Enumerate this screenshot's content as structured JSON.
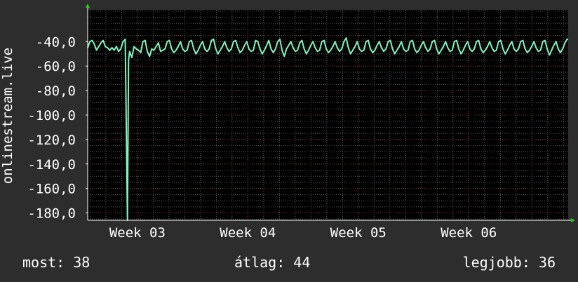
{
  "chart_data": {
    "type": "line",
    "ylabel": "onlinestream.live",
    "yticks": [
      "-40,0",
      "-60,0",
      "-80,0",
      "-100,0",
      "-120,0",
      "-140,0",
      "-160,0",
      "-180,0"
    ],
    "ytick_values": [
      -40,
      -60,
      -80,
      -100,
      -120,
      -140,
      -160,
      -180
    ],
    "ylim": [
      -186,
      -14
    ],
    "xticks": [
      "Week 03",
      "Week 04",
      "Week 05",
      "Week 06"
    ],
    "xtick_values": [
      3,
      4,
      5,
      6
    ],
    "xlim": [
      2.55,
      6.9
    ],
    "grid": true,
    "series": [
      {
        "color": "#7ff5bd",
        "points": [
          [
            2.55,
            -45
          ],
          [
            2.57,
            -40
          ],
          [
            2.59,
            -39
          ],
          [
            2.61,
            -42
          ],
          [
            2.63,
            -47
          ],
          [
            2.65,
            -44
          ],
          [
            2.67,
            -41
          ],
          [
            2.69,
            -39
          ],
          [
            2.71,
            -44
          ],
          [
            2.73,
            -45
          ],
          [
            2.75,
            -47
          ],
          [
            2.77,
            -45
          ],
          [
            2.79,
            -47
          ],
          [
            2.81,
            -44
          ],
          [
            2.83,
            -48
          ],
          [
            2.85,
            -46
          ],
          [
            2.87,
            -40
          ],
          [
            2.89,
            -38
          ],
          [
            2.91,
            -186
          ],
          [
            2.92,
            -55
          ],
          [
            2.93,
            -48
          ],
          [
            2.95,
            -53
          ],
          [
            2.97,
            -44
          ],
          [
            2.99,
            -46
          ],
          [
            3.01,
            -47
          ],
          [
            3.03,
            -49
          ],
          [
            3.05,
            -40
          ],
          [
            3.07,
            -39
          ],
          [
            3.09,
            -48
          ],
          [
            3.11,
            -52
          ],
          [
            3.13,
            -46
          ],
          [
            3.15,
            -47
          ],
          [
            3.17,
            -44
          ],
          [
            3.19,
            -41
          ],
          [
            3.21,
            -48
          ],
          [
            3.23,
            -47
          ],
          [
            3.25,
            -46
          ],
          [
            3.27,
            -40
          ],
          [
            3.29,
            -39
          ],
          [
            3.31,
            -46
          ],
          [
            3.33,
            -49
          ],
          [
            3.35,
            -47
          ],
          [
            3.37,
            -44
          ],
          [
            3.39,
            -40
          ],
          [
            3.41,
            -46
          ],
          [
            3.43,
            -48
          ],
          [
            3.45,
            -47
          ],
          [
            3.47,
            -40
          ],
          [
            3.49,
            -39
          ],
          [
            3.51,
            -46
          ],
          [
            3.53,
            -50
          ],
          [
            3.55,
            -47
          ],
          [
            3.57,
            -43
          ],
          [
            3.59,
            -40
          ],
          [
            3.61,
            -46
          ],
          [
            3.63,
            -48
          ],
          [
            3.65,
            -46
          ],
          [
            3.67,
            -39
          ],
          [
            3.69,
            -38
          ],
          [
            3.71,
            -46
          ],
          [
            3.73,
            -50
          ],
          [
            3.75,
            -47
          ],
          [
            3.77,
            -44
          ],
          [
            3.79,
            -40
          ],
          [
            3.81,
            -45
          ],
          [
            3.83,
            -48
          ],
          [
            3.85,
            -46
          ],
          [
            3.87,
            -40
          ],
          [
            3.89,
            -39
          ],
          [
            3.91,
            -45
          ],
          [
            3.93,
            -49
          ],
          [
            3.95,
            -47
          ],
          [
            3.97,
            -43
          ],
          [
            3.99,
            -40
          ],
          [
            4.01,
            -46
          ],
          [
            4.03,
            -48
          ],
          [
            4.05,
            -47
          ],
          [
            4.07,
            -39
          ],
          [
            4.09,
            -40
          ],
          [
            4.11,
            -46
          ],
          [
            4.13,
            -50
          ],
          [
            4.15,
            -47
          ],
          [
            4.17,
            -43
          ],
          [
            4.19,
            -39
          ],
          [
            4.21,
            -46
          ],
          [
            4.23,
            -49
          ],
          [
            4.25,
            -46
          ],
          [
            4.27,
            -40
          ],
          [
            4.29,
            -38
          ],
          [
            4.31,
            -47
          ],
          [
            4.33,
            -52
          ],
          [
            4.35,
            -46
          ],
          [
            4.37,
            -43
          ],
          [
            4.39,
            -40
          ],
          [
            4.41,
            -45
          ],
          [
            4.43,
            -48
          ],
          [
            4.45,
            -47
          ],
          [
            4.47,
            -41
          ],
          [
            4.49,
            -39
          ],
          [
            4.51,
            -46
          ],
          [
            4.53,
            -50
          ],
          [
            4.55,
            -47
          ],
          [
            4.57,
            -43
          ],
          [
            4.59,
            -40
          ],
          [
            4.61,
            -45
          ],
          [
            4.63,
            -48
          ],
          [
            4.65,
            -47
          ],
          [
            4.67,
            -40
          ],
          [
            4.69,
            -39
          ],
          [
            4.71,
            -46
          ],
          [
            4.73,
            -49
          ],
          [
            4.75,
            -47
          ],
          [
            4.77,
            -44
          ],
          [
            4.79,
            -40
          ],
          [
            4.81,
            -45
          ],
          [
            4.83,
            -48
          ],
          [
            4.85,
            -46
          ],
          [
            4.87,
            -40
          ],
          [
            4.89,
            -37
          ],
          [
            4.91,
            -45
          ],
          [
            4.93,
            -50
          ],
          [
            4.95,
            -47
          ],
          [
            4.97,
            -44
          ],
          [
            4.99,
            -40
          ],
          [
            5.01,
            -46
          ],
          [
            5.03,
            -48
          ],
          [
            5.05,
            -47
          ],
          [
            5.07,
            -40
          ],
          [
            5.09,
            -39
          ],
          [
            5.11,
            -46
          ],
          [
            5.13,
            -49
          ],
          [
            5.15,
            -47
          ],
          [
            5.17,
            -43
          ],
          [
            5.19,
            -40
          ],
          [
            5.21,
            -45
          ],
          [
            5.23,
            -48
          ],
          [
            5.25,
            -46
          ],
          [
            5.27,
            -40
          ],
          [
            5.29,
            -39
          ],
          [
            5.31,
            -46
          ],
          [
            5.33,
            -50
          ],
          [
            5.35,
            -47
          ],
          [
            5.37,
            -44
          ],
          [
            5.39,
            -40
          ],
          [
            5.41,
            -46
          ],
          [
            5.43,
            -48
          ],
          [
            5.45,
            -47
          ],
          [
            5.47,
            -40
          ],
          [
            5.49,
            -39
          ],
          [
            5.51,
            -46
          ],
          [
            5.53,
            -49
          ],
          [
            5.55,
            -47
          ],
          [
            5.57,
            -43
          ],
          [
            5.59,
            -40
          ],
          [
            5.61,
            -45
          ],
          [
            5.63,
            -48
          ],
          [
            5.65,
            -46
          ],
          [
            5.67,
            -40
          ],
          [
            5.69,
            -39
          ],
          [
            5.71,
            -46
          ],
          [
            5.73,
            -50
          ],
          [
            5.75,
            -47
          ],
          [
            5.77,
            -44
          ],
          [
            5.79,
            -40
          ],
          [
            5.81,
            -45
          ],
          [
            5.83,
            -48
          ],
          [
            5.85,
            -47
          ],
          [
            5.87,
            -40
          ],
          [
            5.89,
            -39
          ],
          [
            5.91,
            -46
          ],
          [
            5.93,
            -50
          ],
          [
            5.95,
            -47
          ],
          [
            5.97,
            -43
          ],
          [
            5.99,
            -40
          ],
          [
            6.01,
            -46
          ],
          [
            6.03,
            -48
          ],
          [
            6.05,
            -46
          ],
          [
            6.07,
            -40
          ],
          [
            6.09,
            -39
          ],
          [
            6.11,
            -46
          ],
          [
            6.13,
            -49
          ],
          [
            6.15,
            -47
          ],
          [
            6.17,
            -44
          ],
          [
            6.19,
            -40
          ],
          [
            6.21,
            -45
          ],
          [
            6.23,
            -48
          ],
          [
            6.25,
            -47
          ],
          [
            6.27,
            -40
          ],
          [
            6.29,
            -39
          ],
          [
            6.31,
            -46
          ],
          [
            6.33,
            -50
          ],
          [
            6.35,
            -47
          ],
          [
            6.37,
            -43
          ],
          [
            6.39,
            -40
          ],
          [
            6.41,
            -46
          ],
          [
            6.43,
            -48
          ],
          [
            6.45,
            -46
          ],
          [
            6.47,
            -40
          ],
          [
            6.49,
            -39
          ],
          [
            6.51,
            -46
          ],
          [
            6.53,
            -49
          ],
          [
            6.55,
            -47
          ],
          [
            6.57,
            -44
          ],
          [
            6.59,
            -40
          ],
          [
            6.61,
            -45
          ],
          [
            6.63,
            -48
          ],
          [
            6.65,
            -47
          ],
          [
            6.67,
            -40
          ],
          [
            6.69,
            -39
          ],
          [
            6.71,
            -46
          ],
          [
            6.73,
            -51
          ],
          [
            6.75,
            -47
          ],
          [
            6.77,
            -43
          ],
          [
            6.79,
            -40
          ],
          [
            6.81,
            -46
          ],
          [
            6.83,
            -49
          ],
          [
            6.85,
            -46
          ],
          [
            6.87,
            -41
          ],
          [
            6.89,
            -38
          ],
          [
            6.9,
            -38
          ]
        ]
      }
    ],
    "colors": {
      "background": "#2d2d2d",
      "plot_background": "#000000",
      "grid": "#5a5a5a",
      "grid_major": "#8a2f2f",
      "axis": "#ffffff",
      "arrow": "#22cc22"
    }
  },
  "stats": {
    "most": "most: 38",
    "avg": "átlag: 44",
    "best": "legjobb: 36"
  }
}
